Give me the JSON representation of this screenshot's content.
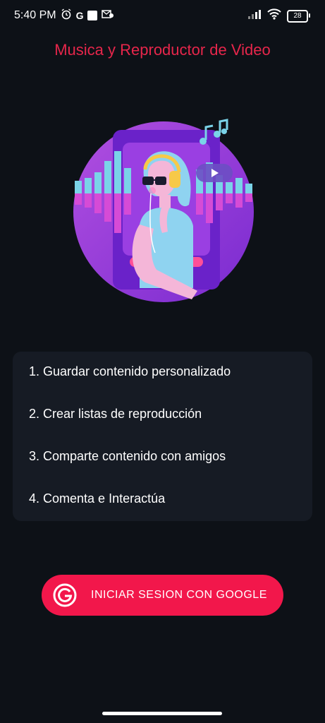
{
  "status_bar": {
    "time": "5:40 PM",
    "g_label": "G",
    "battery": "28",
    "icons": [
      "alarm-icon",
      "google-g-icon",
      "notification-square-icon",
      "mail-icon",
      "signal-icon",
      "wifi-icon",
      "battery-icon"
    ]
  },
  "app": {
    "title": "Musica y Reproductor de Video",
    "title_color": "#e6264b"
  },
  "features": {
    "items": [
      "1. Guardar contenido personalizado",
      "2. Crear listas de reproducción",
      "3. Comparte contenido con amigos",
      "4. Comenta e Interactúa"
    ]
  },
  "login": {
    "google_button_label": "INICIAR SESION CON GOOGLE",
    "button_color": "#f2174b"
  }
}
